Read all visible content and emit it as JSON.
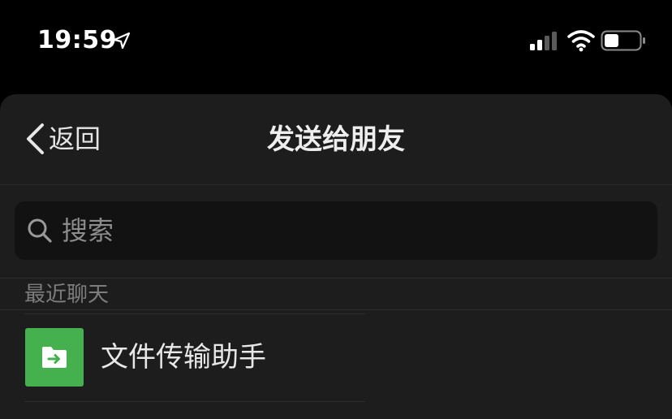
{
  "status_bar": {
    "time": "19:59",
    "icons": [
      "location-arrow-icon",
      "cellular-signal-icon",
      "wifi-icon",
      "battery-icon"
    ]
  },
  "nav": {
    "back_label": "返回",
    "title": "发送给朋友"
  },
  "search": {
    "placeholder": "搜索"
  },
  "recent": {
    "header": "最近聊天",
    "items": [
      {
        "name": "文件传输助手",
        "avatar_icon": "file-transfer-icon",
        "avatar_color": "#45b04e"
      }
    ]
  },
  "colors": {
    "background": "#000000",
    "sheet": "#1d1d1d",
    "search_field": "#121212",
    "accent_green": "#45b04e"
  }
}
